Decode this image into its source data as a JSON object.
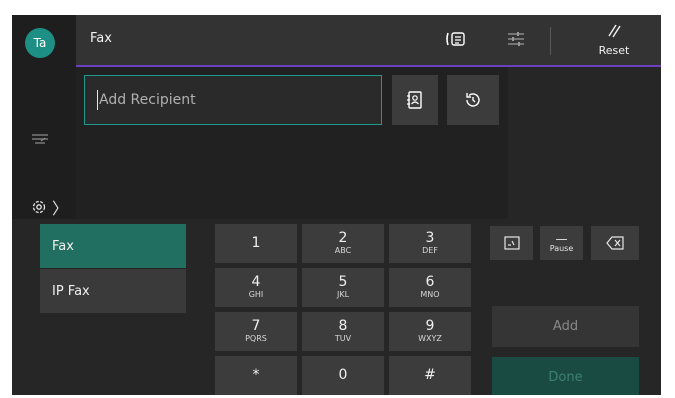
{
  "user": {
    "initials": "Ta"
  },
  "header": {
    "title": "Fax",
    "reset_label": "Reset",
    "fax_icon": "fax-icon",
    "adjust_icon": "sliders-icon"
  },
  "recipient": {
    "placeholder": "Add Recipient",
    "address_book_icon": "address-book-icon",
    "history_icon": "history-icon"
  },
  "modes": [
    {
      "label": "Fax",
      "selected": true
    },
    {
      "label": "IP Fax",
      "selected": false
    }
  ],
  "keypad": [
    {
      "digit": "1",
      "letters": ""
    },
    {
      "digit": "2",
      "letters": "ABC"
    },
    {
      "digit": "3",
      "letters": "DEF"
    },
    {
      "digit": "4",
      "letters": "GHI"
    },
    {
      "digit": "5",
      "letters": "JKL"
    },
    {
      "digit": "6",
      "letters": "MNO"
    },
    {
      "digit": "7",
      "letters": "PQRS"
    },
    {
      "digit": "8",
      "letters": "TUV"
    },
    {
      "digit": "9",
      "letters": "WXYZ"
    },
    {
      "digit": "*",
      "letters": ""
    },
    {
      "digit": "0",
      "letters": ""
    },
    {
      "digit": "#",
      "letters": ""
    }
  ],
  "controls": {
    "pause_label": "Pause",
    "pause_symbol": "—",
    "add_label": "Add",
    "done_label": "Done"
  },
  "colors": {
    "accent": "#1e9a8c",
    "selected_mode": "#216f60",
    "header_underline": "#6d3fbf",
    "done": "#1a4b43"
  }
}
